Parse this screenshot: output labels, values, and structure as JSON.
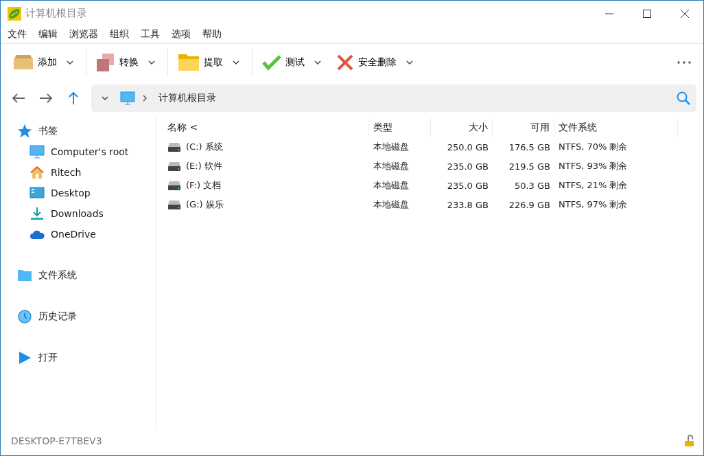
{
  "window": {
    "title": "计算机根目录"
  },
  "menu": [
    "文件",
    "编辑",
    "浏览器",
    "组织",
    "工具",
    "选项",
    "帮助"
  ],
  "toolbar": [
    {
      "label": "添加",
      "kind": "box"
    },
    {
      "label": "转换",
      "kind": "squares"
    },
    {
      "label": "提取",
      "kind": "folder"
    },
    {
      "label": "测试",
      "kind": "check"
    },
    {
      "label": "安全删除",
      "kind": "cross"
    }
  ],
  "address": {
    "path": "计算机根目录"
  },
  "sidebar": [
    {
      "label": "书签",
      "kind": "star",
      "children": [
        {
          "label": "Computer's root",
          "kind": "monitor"
        },
        {
          "label": "Ritech",
          "kind": "home"
        },
        {
          "label": "Desktop",
          "kind": "desktop"
        },
        {
          "label": "Downloads",
          "kind": "download"
        },
        {
          "label": "OneDrive",
          "kind": "cloud"
        }
      ]
    },
    {
      "label": "文件系统",
      "kind": "folder"
    },
    {
      "label": "历史记录",
      "kind": "history"
    },
    {
      "label": "打开",
      "kind": "play"
    }
  ],
  "table": {
    "columns": [
      "名称 <",
      "类型",
      "大小",
      "可用",
      "文件系统"
    ],
    "rows": [
      [
        "(C:) 系统",
        "本地磁盘",
        "250.0 GB",
        "176.5 GB",
        "NTFS, 70% 剩余"
      ],
      [
        "(E:) 软件",
        "本地磁盘",
        "235.0 GB",
        "219.5 GB",
        "NTFS, 93% 剩余"
      ],
      [
        "(F:) 文档",
        "本地磁盘",
        "235.0 GB",
        "50.3 GB",
        "NTFS, 21% 剩余"
      ],
      [
        "(G:) 娱乐",
        "本地磁盘",
        "233.8 GB",
        "226.9 GB",
        "NTFS, 97% 剩余"
      ]
    ]
  },
  "status_bar": {
    "computer": "DESKTOP-E7TBEV3"
  }
}
